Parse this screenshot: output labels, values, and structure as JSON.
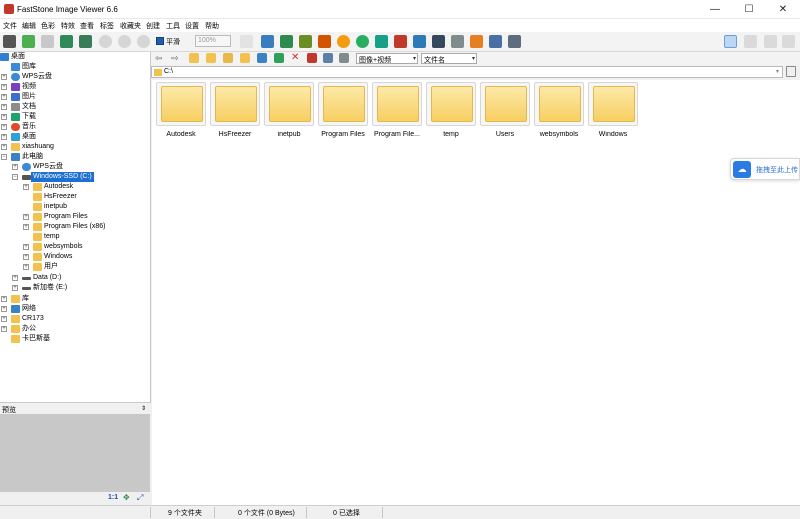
{
  "window": {
    "title": "FastStone Image Viewer 6.6",
    "minimize": "—",
    "maximize": "☐",
    "close": "✕"
  },
  "menu": [
    "文件",
    "编辑",
    "色彩",
    "特效",
    "查看",
    "标签",
    "收藏夹",
    "创建",
    "工具",
    "设置",
    "帮助"
  ],
  "toolbar": {
    "smooth_label": "平滑",
    "zoom_value": "100%"
  },
  "tree": [
    {
      "label": "桌面",
      "icon": "desktop-icon",
      "color": "#2f7fd6"
    },
    {
      "label": "图库",
      "icon": "gallery-icon",
      "color": "#3a8ad8"
    },
    {
      "label": "WPS云盘",
      "icon": "cloud-icon",
      "color": "#3a8ad8"
    },
    {
      "label": "视频",
      "icon": "video-icon",
      "color": "#7a3fc0"
    },
    {
      "label": "图片",
      "icon": "pictures-icon",
      "color": "#3a6fd0"
    },
    {
      "label": "文档",
      "icon": "documents-icon",
      "color": "#8c8c8c"
    },
    {
      "label": "下载",
      "icon": "download-icon",
      "color": "#1fa36a"
    },
    {
      "label": "音乐",
      "icon": "music-icon",
      "color": "#e04a2a"
    },
    {
      "label": "桌面",
      "icon": "desktop-icon",
      "color": "#2fa0d6"
    },
    {
      "label": "xiashuang",
      "icon": "folder-icon",
      "color": "#f2c14e"
    },
    {
      "label": "此电脑",
      "icon": "computer-icon",
      "color": "#3b82c4"
    },
    {
      "label": "WPS云盘",
      "icon": "cloud-icon",
      "color": "#3a8ad8"
    },
    {
      "label": "Windows-SSD (C:)",
      "icon": "drive-icon",
      "color": "#555555"
    },
    {
      "label": "Autodesk",
      "icon": "folder-icon",
      "color": "#f2c14e"
    },
    {
      "label": "HsFreezer",
      "icon": "folder-icon",
      "color": "#f2c14e"
    },
    {
      "label": "inetpub",
      "icon": "folder-icon",
      "color": "#f2c14e"
    },
    {
      "label": "Program Files",
      "icon": "folder-icon",
      "color": "#f2c14e"
    },
    {
      "label": "Program Files (x86)",
      "icon": "folder-icon",
      "color": "#f2c14e"
    },
    {
      "label": "temp",
      "icon": "folder-icon",
      "color": "#f2c14e"
    },
    {
      "label": "websymbols",
      "icon": "folder-icon",
      "color": "#f2c14e"
    },
    {
      "label": "Windows",
      "icon": "folder-icon",
      "color": "#f2c14e"
    },
    {
      "label": "用户",
      "icon": "folder-icon",
      "color": "#f2c14e"
    },
    {
      "label": "Data (D:)",
      "icon": "drive-icon",
      "color": "#555555"
    },
    {
      "label": "新加卷 (E:)",
      "icon": "drive-icon",
      "color": "#555555"
    },
    {
      "label": "库",
      "icon": "folder-icon",
      "color": "#f2c14e"
    },
    {
      "label": "网络",
      "icon": "network-icon",
      "color": "#3b82c4"
    },
    {
      "label": "CR173",
      "icon": "folder-icon",
      "color": "#f2c14e"
    },
    {
      "label": "办公",
      "icon": "folder-icon",
      "color": "#f2c14e"
    },
    {
      "label": "卡巴斯基",
      "icon": "folder-icon",
      "color": "#f2c14e"
    }
  ],
  "preview": {
    "title": "预览",
    "ratio_label": "1:1"
  },
  "file_toolbar": {
    "filter_value": "图像+视频",
    "sort_value": "文件名"
  },
  "path": "C:\\",
  "thumbnails": [
    "Autodesk",
    "HsFreezer",
    "inetpub",
    "Program Files",
    "Program File...",
    "temp",
    "Users",
    "websymbols",
    "Windows"
  ],
  "status": {
    "folders": "9 个文件夹",
    "files": "0 个文件 (0 Bytes)",
    "selected": "0 已选择"
  },
  "wps_float": {
    "label": "拖拽至此上传"
  },
  "colors": {
    "selection": "#1d6fd1",
    "accent": "#2a7be4"
  }
}
